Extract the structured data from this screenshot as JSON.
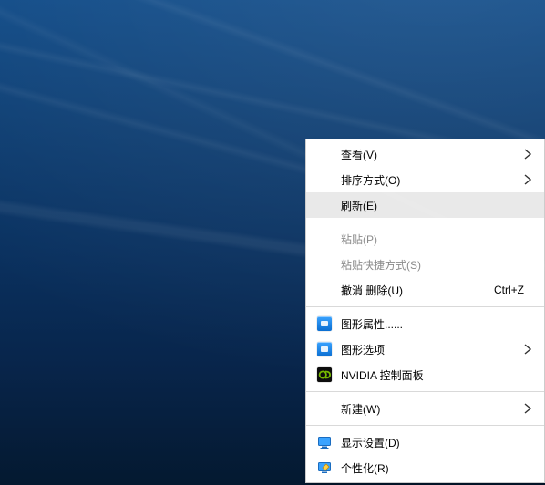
{
  "context_menu": {
    "group1": {
      "view": {
        "label": "查看(V)",
        "has_submenu": true
      },
      "sort": {
        "label": "排序方式(O)",
        "has_submenu": true
      },
      "refresh": {
        "label": "刷新(E)"
      }
    },
    "group2": {
      "paste": {
        "label": "粘贴(P)"
      },
      "paste_shortcut": {
        "label": "粘贴快捷方式(S)"
      },
      "undo_delete": {
        "label": "撤消 删除(U)",
        "accel": "Ctrl+Z"
      }
    },
    "group3": {
      "gfx_props": {
        "label": "图形属性......"
      },
      "gfx_options": {
        "label": "图形选项",
        "has_submenu": true
      },
      "nvidia": {
        "label": "NVIDIA 控制面板"
      }
    },
    "group4": {
      "new": {
        "label": "新建(W)",
        "has_submenu": true
      }
    },
    "group5": {
      "display": {
        "label": "显示设置(D)"
      },
      "personalize": {
        "label": "个性化(R)"
      }
    }
  }
}
